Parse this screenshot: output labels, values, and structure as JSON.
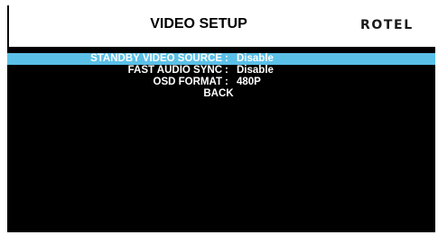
{
  "header": {
    "title": "VIDEO SETUP",
    "logo": "ROTEL"
  },
  "menu": {
    "items": [
      {
        "label": "STANDBY VIDEO SOURCE",
        "separator": ":",
        "value": "Disable",
        "selected": true
      },
      {
        "label": "FAST AUDIO SYNC",
        "separator": ":",
        "value": "Disable",
        "selected": false
      },
      {
        "label": "OSD FORMAT",
        "separator": ":",
        "value": "480P",
        "selected": false
      }
    ],
    "back_label": "BACK"
  },
  "colors": {
    "background": "#000000",
    "header_background": "#ffffff",
    "highlight": "#5bc0e8",
    "text": "#ffffff"
  }
}
